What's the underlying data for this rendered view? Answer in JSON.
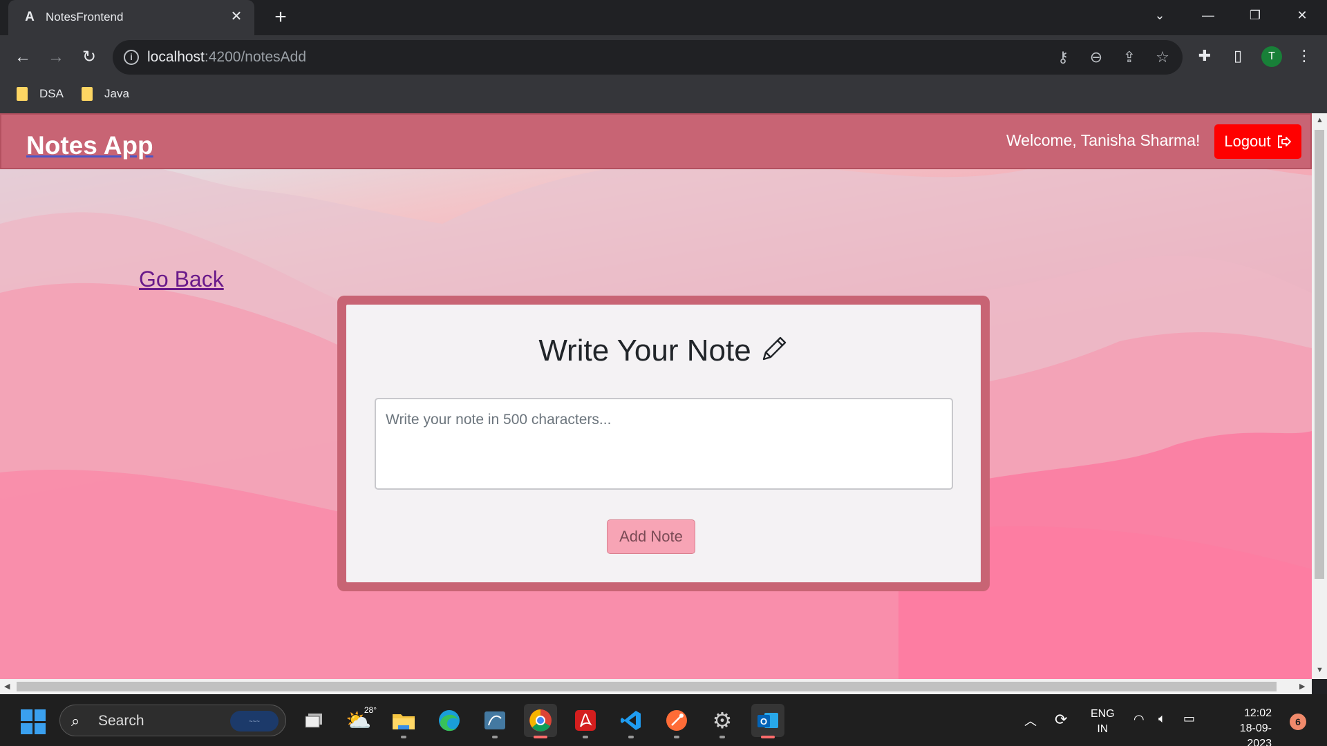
{
  "browser": {
    "tab_title": "NotesFrontend",
    "new_tab_symbol": "+",
    "url_host": "localhost",
    "url_rest": ":4200/notesAdd",
    "profile_initial": "T",
    "bookmarks": [
      {
        "label": "DSA"
      },
      {
        "label": "Java"
      }
    ]
  },
  "app": {
    "brand": "Notes App",
    "welcome": "Welcome, Tanisha Sharma!",
    "logout_label": "Logout",
    "go_back": "Go Back",
    "card_title": "Write Your Note",
    "note_placeholder": "Write your note in 500 characters...",
    "add_button": "Add Note",
    "colors": {
      "navbar": "#c86474",
      "logout": "#ff0000",
      "card_border": "#c86474",
      "add_button": "#f7a4b5"
    }
  },
  "taskbar": {
    "search_label": "Search",
    "weather_temp": "28°",
    "lang_line1": "ENG",
    "lang_line2": "IN",
    "time": "12:02",
    "date": "18-09-2023",
    "notification_count": "6",
    "apps": [
      "file-explorer",
      "edge",
      "mysql-workbench",
      "chrome",
      "acrobat",
      "vscode",
      "postman",
      "settings",
      "outlook"
    ]
  }
}
